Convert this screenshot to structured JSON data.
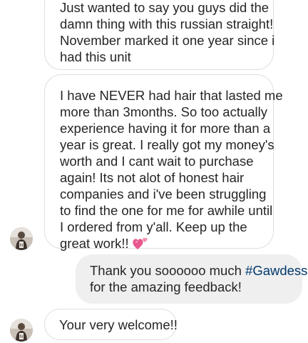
{
  "conversation": {
    "messages": [
      {
        "sender": "customer",
        "lines": [
          "Just wanted to say you guys did the",
          "damn thing with this russian straight!",
          "November marked it one year since i",
          "had this unit"
        ]
      },
      {
        "sender": "customer",
        "lines": [
          "I have NEVER had hair that lasted me",
          "more than 3months. So too actually",
          "experience having it for more than a",
          "year is great. I really got my money's",
          "worth and I cant wait to purchase",
          "again! Its not alot of honest hair",
          "companies and i've been struggling",
          "to find the one for me for awhile until",
          "I ordered from y'all. Keep up the",
          "great work!!"
        ],
        "emoji": "two-hearts-icon"
      },
      {
        "sender": "business",
        "line1_text": "Thank you soooooo much ",
        "line1_hashtag": "#Gawdess",
        "line2": "for the amazing feedback!"
      },
      {
        "sender": "customer",
        "lines": [
          "Your very welcome!!"
        ]
      }
    ]
  },
  "colors": {
    "incoming_bubble_border": "#dedede",
    "outgoing_bubble_bg": "#efefef",
    "text": "#262626",
    "hashtag": "#00376b",
    "heart": "#e8588f"
  }
}
